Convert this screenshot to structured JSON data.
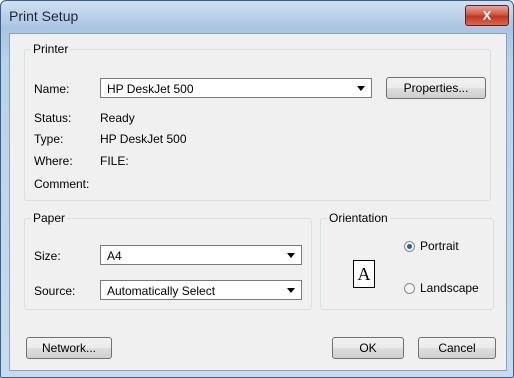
{
  "window": {
    "title": "Print Setup",
    "close_label": "X"
  },
  "printer": {
    "group_label": "Printer",
    "name_label": "Name:",
    "name_value": "HP DeskJet 500",
    "properties_label": "Properties...",
    "status_label": "Status:",
    "status_value": "Ready",
    "type_label": "Type:",
    "type_value": "HP DeskJet 500",
    "where_label": "Where:",
    "where_value": "FILE:",
    "comment_label": "Comment:"
  },
  "paper": {
    "group_label": "Paper",
    "size_label": "Size:",
    "size_value": "A4",
    "source_label": "Source:",
    "source_value": "Automatically Select"
  },
  "orientation": {
    "group_label": "Orientation",
    "page_glyph": "A",
    "portrait_label": "Portrait",
    "landscape_label": "Landscape",
    "selected": "Portrait"
  },
  "buttons": {
    "network": "Network...",
    "ok": "OK",
    "cancel": "Cancel"
  },
  "colors": {
    "title_frame": "#a9c4e2",
    "close_button": "#c23521",
    "face": "#f0f0f0"
  }
}
